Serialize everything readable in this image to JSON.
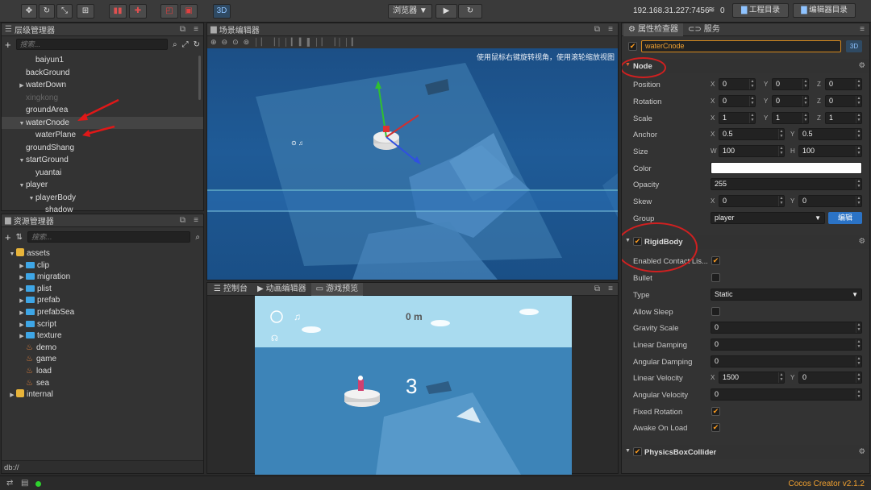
{
  "toolbar": {
    "btn_3d": "3D",
    "browser_label": "浏览器 ▼",
    "ip": "192.168.31.227:7456",
    "wifi_count": "0",
    "project_dir": "工程目录",
    "editor_dir": "编辑器目录"
  },
  "hierarchy": {
    "title": "层级管理器",
    "search_placeholder": "搜索...",
    "nodes": [
      {
        "label": "baiyun1",
        "indent": 2,
        "arrow": "",
        "dim": false,
        "sel": false
      },
      {
        "label": "backGround",
        "indent": 1,
        "arrow": "",
        "dim": false,
        "sel": false
      },
      {
        "label": "waterDown",
        "indent": 1,
        "arrow": "▶",
        "dim": false,
        "sel": false
      },
      {
        "label": "xingkong",
        "indent": 1,
        "arrow": "",
        "dim": true,
        "sel": false
      },
      {
        "label": "groundArea",
        "indent": 1,
        "arrow": "",
        "dim": false,
        "sel": false
      },
      {
        "label": "waterCnode",
        "indent": 1,
        "arrow": "▼",
        "dim": false,
        "sel": true
      },
      {
        "label": "waterPlane",
        "indent": 2,
        "arrow": "",
        "dim": false,
        "sel": false
      },
      {
        "label": "groundShang",
        "indent": 1,
        "arrow": "",
        "dim": false,
        "sel": false
      },
      {
        "label": "startGround",
        "indent": 1,
        "arrow": "▼",
        "dim": false,
        "sel": false
      },
      {
        "label": "yuantai",
        "indent": 2,
        "arrow": "",
        "dim": false,
        "sel": false
      },
      {
        "label": "player",
        "indent": 1,
        "arrow": "▼",
        "dim": false,
        "sel": false
      },
      {
        "label": "playerBody",
        "indent": 2,
        "arrow": "▼",
        "dim": false,
        "sel": false
      },
      {
        "label": "shadow",
        "indent": 3,
        "arrow": "",
        "dim": false,
        "sel": false
      }
    ]
  },
  "assets": {
    "title": "资源管理器",
    "search_placeholder": "搜索...",
    "items": [
      {
        "label": "assets",
        "indent": 0,
        "arrow": "▼",
        "kind": "asset"
      },
      {
        "label": "clip",
        "indent": 1,
        "arrow": "▶",
        "kind": "folder"
      },
      {
        "label": "migration",
        "indent": 1,
        "arrow": "▶",
        "kind": "folder"
      },
      {
        "label": "plist",
        "indent": 1,
        "arrow": "▶",
        "kind": "folder"
      },
      {
        "label": "prefab",
        "indent": 1,
        "arrow": "▶",
        "kind": "folder"
      },
      {
        "label": "prefabSea",
        "indent": 1,
        "arrow": "▶",
        "kind": "folder"
      },
      {
        "label": "script",
        "indent": 1,
        "arrow": "▶",
        "kind": "folder"
      },
      {
        "label": "texture",
        "indent": 1,
        "arrow": "▶",
        "kind": "folder"
      },
      {
        "label": "demo",
        "indent": 1,
        "arrow": "",
        "kind": "scene"
      },
      {
        "label": "game",
        "indent": 1,
        "arrow": "",
        "kind": "scene"
      },
      {
        "label": "load",
        "indent": 1,
        "arrow": "",
        "kind": "scene"
      },
      {
        "label": "sea",
        "indent": 1,
        "arrow": "",
        "kind": "scene"
      },
      {
        "label": "internal",
        "indent": 0,
        "arrow": "▶",
        "kind": "asset"
      }
    ],
    "footer": "db://"
  },
  "scene": {
    "title": "场景编辑器",
    "hint": "使用鼠标右键旋转视角，使用滚轮缩放视图"
  },
  "bottom_tabs": {
    "console": "控制台",
    "animation": "动画编辑器",
    "preview": "游戏预览"
  },
  "game_preview": {
    "distance": "0 m",
    "countdown": "3"
  },
  "inspector": {
    "tab_props": "属性检查器",
    "tab_service": "服务",
    "node_name": "waterCnode",
    "btn_3d": "3D",
    "node_section": "Node",
    "position_label": "Position",
    "position": [
      "0",
      "0",
      "0"
    ],
    "rotation_label": "Rotation",
    "rotation": [
      "0",
      "0",
      "0"
    ],
    "scale_label": "Scale",
    "scale": [
      "1",
      "1",
      "1"
    ],
    "anchor_label": "Anchor",
    "anchor": [
      "0.5",
      "0.5"
    ],
    "size_label": "Size",
    "size": [
      "100",
      "100"
    ],
    "color_label": "Color",
    "opacity_label": "Opacity",
    "opacity": "255",
    "skew_label": "Skew",
    "skew": [
      "0",
      "0"
    ],
    "group_label": "Group",
    "group": "player",
    "edit_btn": "编辑",
    "rigidbody_section": "RigidBody",
    "enabled_contact_label": "Enabled Contact Lis...",
    "bullet_label": "Bullet",
    "type_label": "Type",
    "type_value": "Static",
    "allow_sleep_label": "Allow Sleep",
    "gravity_label": "Gravity Scale",
    "gravity": "0",
    "linear_damping_label": "Linear Damping",
    "linear_damping": "0",
    "angular_damping_label": "Angular Damping",
    "angular_damping": "0",
    "linear_velocity_label": "Linear Velocity",
    "linear_velocity": [
      "1500",
      "0"
    ],
    "angular_velocity_label": "Angular Velocity",
    "angular_velocity": "0",
    "fixed_rotation_label": "Fixed Rotation",
    "awake_label": "Awake On Load",
    "collider_section": "PhysicsBoxCollider"
  },
  "status": {
    "version": "Cocos Creator v2.1.2"
  }
}
